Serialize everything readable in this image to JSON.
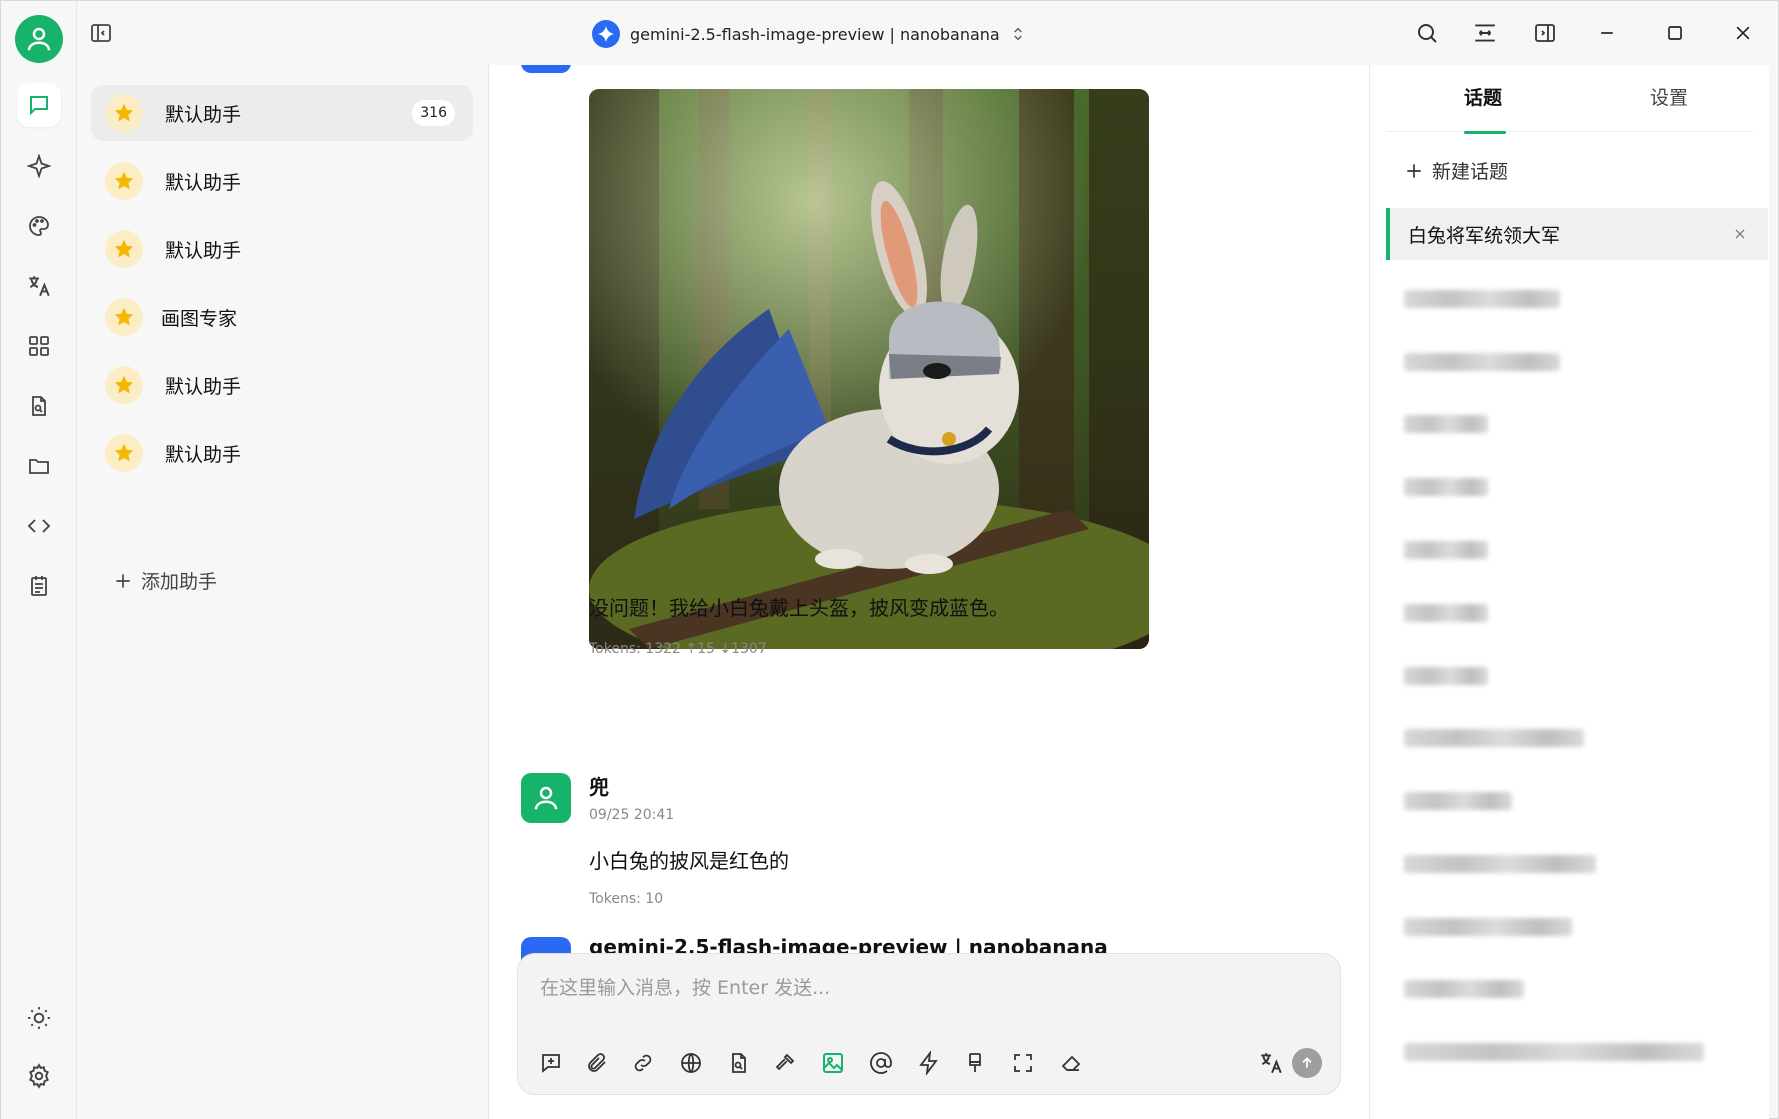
{
  "window": {
    "model_title": "gemini-2.5-flash-image-preview | nanobanana"
  },
  "rail": {
    "items": [
      {
        "name": "chat-icon"
      },
      {
        "name": "sparkle-icon"
      },
      {
        "name": "palette-icon"
      },
      {
        "name": "translate-icon"
      },
      {
        "name": "apps-grid-icon"
      },
      {
        "name": "document-search-icon"
      },
      {
        "name": "folder-icon"
      },
      {
        "name": "code-icon"
      },
      {
        "name": "notes-icon"
      }
    ],
    "bottom": [
      {
        "name": "theme-sun-icon"
      },
      {
        "name": "settings-gear-icon"
      }
    ]
  },
  "assistants": {
    "items": [
      {
        "label": "默认助手",
        "count": "316",
        "active": true
      },
      {
        "label": "默认助手"
      },
      {
        "label": "默认助手"
      },
      {
        "label": "画图专家"
      },
      {
        "label": "默认助手"
      },
      {
        "label": "默认助手"
      }
    ],
    "add_label": "添加助手"
  },
  "chat": {
    "assistant_reply": "没问题！我给小白兔戴上头盔，披风变成蓝色。",
    "assistant_tokens": "Tokens: 1322 ↑15 ↓1307",
    "user_name": "兜",
    "user_time": "09/25 20:41",
    "user_message": "小白兔的披风是红色的",
    "user_tokens": "Tokens: 10",
    "next_model": "gemini-2.5-flash-image-preview | nanobanana",
    "input_placeholder": "在这里输入消息，按 Enter 发送..."
  },
  "topics": {
    "tab_topics": "话题",
    "tab_settings": "设置",
    "new_topic": "新建话题",
    "active_topic": "白兔将军统领大军"
  },
  "colors": {
    "accent_green": "#18b36a",
    "gemini_blue": "#2a6af3",
    "star_yellow": "#f5b800"
  }
}
